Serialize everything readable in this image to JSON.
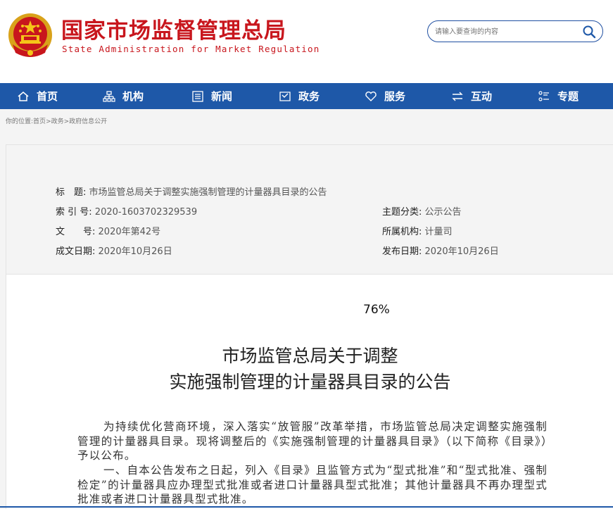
{
  "header": {
    "title": "国家市场监督管理总局",
    "subtitle": "State Administration for Market Regulation",
    "search_placeholder": "请输入要查询的内容",
    "brand_color": "#c8161d",
    "nav_color": "#1e58a8"
  },
  "nav": {
    "items": [
      {
        "label": "首页",
        "icon": "home-icon"
      },
      {
        "label": "机构",
        "icon": "org-chart-icon"
      },
      {
        "label": "新闻",
        "icon": "news-icon"
      },
      {
        "label": "政务",
        "icon": "government-icon"
      },
      {
        "label": "服务",
        "icon": "heart-icon"
      },
      {
        "label": "互动",
        "icon": "exchange-icon"
      },
      {
        "label": "专题",
        "icon": "topic-list-icon"
      }
    ]
  },
  "breadcrumb": {
    "prefix": "你的位置:",
    "items": [
      "首页",
      "政务",
      "政府信息公开"
    ],
    "separator": ">"
  },
  "meta": {
    "title_key": "标　题:",
    "title_val": "市场监管总局关于调整实施强制管理的计量器具目录的公告",
    "index_key": "索 引 号:",
    "index_val": "2020-1603702329539",
    "doc_no_key": "文　　号:",
    "doc_no_val": "2020年第42号",
    "date_key": "成文日期:",
    "date_val": "2020年10月26日",
    "category_key": "主题分类:",
    "category_val": "公示公告",
    "org_key": "所属机构:",
    "org_val": "计量司",
    "publish_key": "发布日期:",
    "publish_val": "2020年10月26日"
  },
  "document": {
    "zoom": "76%",
    "title_line1": "市场监管总局关于调整",
    "title_line2": "实施强制管理的计量器具目录的公告",
    "para1": "为持续优化营商环境，深入落实“放管服”改革举措，市场监管总局决定调整实施强制管理的计量器具目录。现将调整后的《实施强制管理的计量器具目录》（以下简称《目录》）予以公布。",
    "para2": "一、自本公告发布之日起，列入《目录》且监管方式为“型式批准”和“型式批准、强制检定”的计量器具应办理型式批准或者进口计量器具型式批准；其他计量器具不再办理型式批准或者进口计量器具型式批准。"
  }
}
